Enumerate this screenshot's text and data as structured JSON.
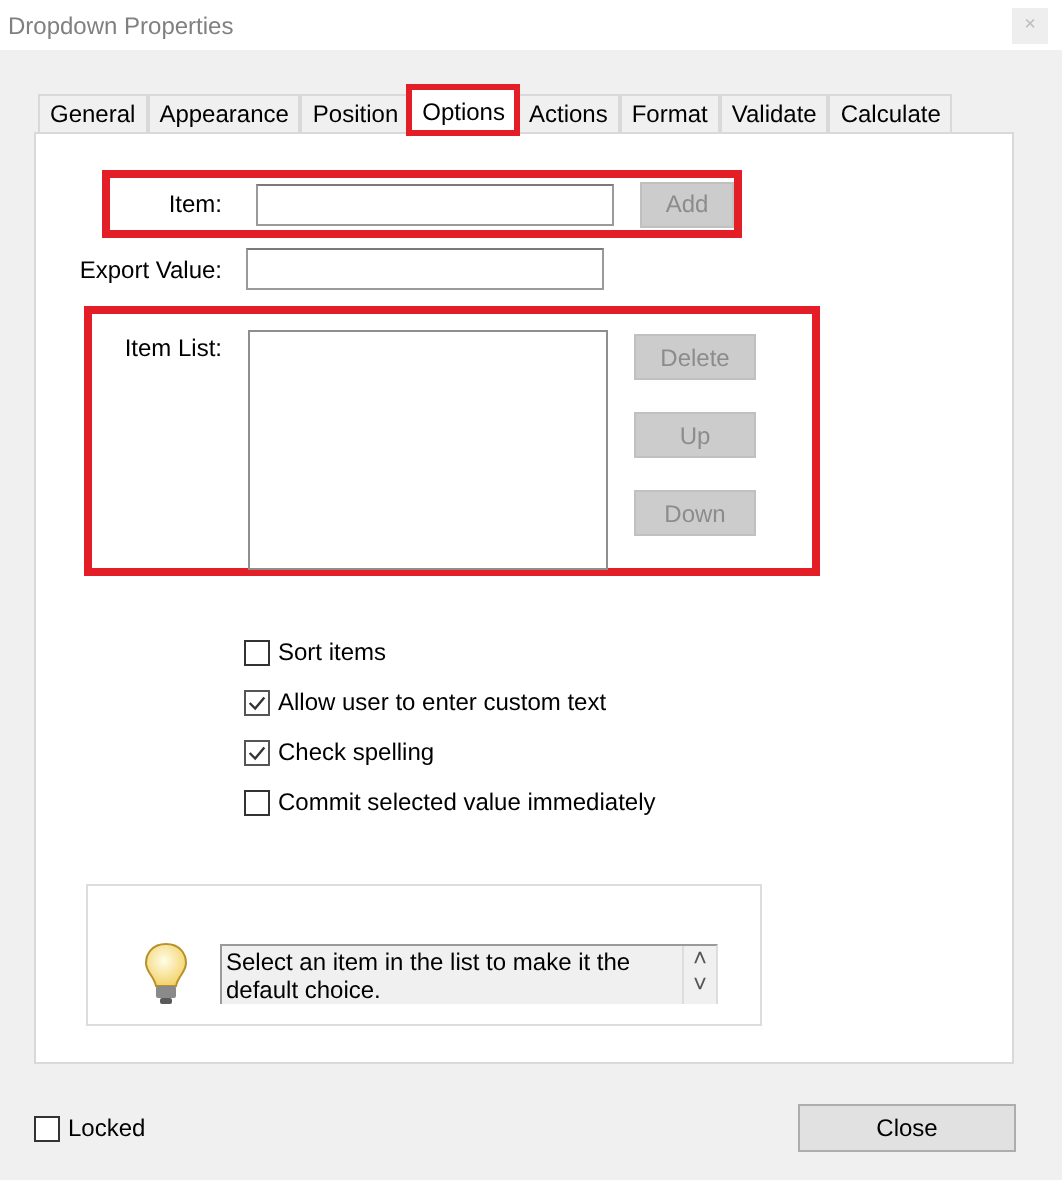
{
  "window": {
    "title": "Dropdown Properties",
    "close_icon": "×"
  },
  "tabs": [
    {
      "label": "General",
      "selected": false,
      "highlighted": false
    },
    {
      "label": "Appearance",
      "selected": false,
      "highlighted": false
    },
    {
      "label": "Position",
      "selected": false,
      "highlighted": false
    },
    {
      "label": "Options",
      "selected": true,
      "highlighted": true
    },
    {
      "label": "Actions",
      "selected": false,
      "highlighted": false
    },
    {
      "label": "Format",
      "selected": false,
      "highlighted": false
    },
    {
      "label": "Validate",
      "selected": false,
      "highlighted": false
    },
    {
      "label": "Calculate",
      "selected": false,
      "highlighted": false
    }
  ],
  "item": {
    "label": "Item:",
    "button": "Add",
    "button_disabled": true,
    "highlighted": true
  },
  "export_value": {
    "label": "Export Value:"
  },
  "item_list": {
    "label": "Item List:",
    "highlighted": true,
    "buttons": [
      {
        "label": "Delete",
        "disabled": true
      },
      {
        "label": "Up",
        "disabled": true
      },
      {
        "label": "Down",
        "disabled": true
      }
    ]
  },
  "options": [
    {
      "label": "Sort items",
      "checked": false
    },
    {
      "label": "Allow user to enter custom text",
      "checked": true
    },
    {
      "label": "Check spelling",
      "checked": true
    },
    {
      "label": "Commit selected value immediately",
      "checked": false
    }
  ],
  "hint": {
    "text": "Select an item in the list to make it the default choice.",
    "up_arrow": "˄",
    "down_arrow": "˅"
  },
  "locked": {
    "label": "Locked",
    "checked": false
  },
  "close_button": "Close"
}
